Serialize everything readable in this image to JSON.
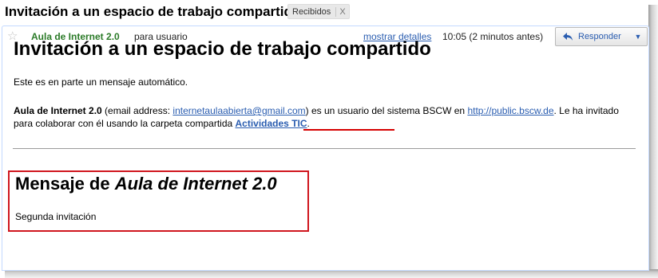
{
  "subject": "Invitación a un espacio de trabajo compartido",
  "label": {
    "name": "Recibidos",
    "remove": "X"
  },
  "header": {
    "sender": "Aula de Internet 2.0",
    "recipient_text": "para usuario",
    "details_link": "mostrar detalles",
    "time": "10:05 (2 minutos antes)",
    "reply_label": "Responder",
    "more_icon": "▼"
  },
  "body": {
    "heading": "Invitación a un espacio de trabajo compartido",
    "intro": "Este es en parte un mensaje automático.",
    "sender_name": "Aula de Internet 2.0",
    "email_prefix": " (email address: ",
    "email": "internetaulaabierta@gmail.com",
    "mid_text": ") es un usuario del sistema BSCW en ",
    "bscw_link": "http://public.bscw.de",
    "tail_text": ". Le ha invitado para colaborar con él usando la carpeta compartida ",
    "folder_link": "Actividades TIC",
    "end_text": ".",
    "message_heading_prefix": "Mensaje de ",
    "message_heading_name": "Aula de Internet 2.0",
    "message_text": "Segunda invitación"
  },
  "colors": {
    "sender": "#2a7a27",
    "link": "#2a5db0",
    "highlight": "#d0161e"
  }
}
